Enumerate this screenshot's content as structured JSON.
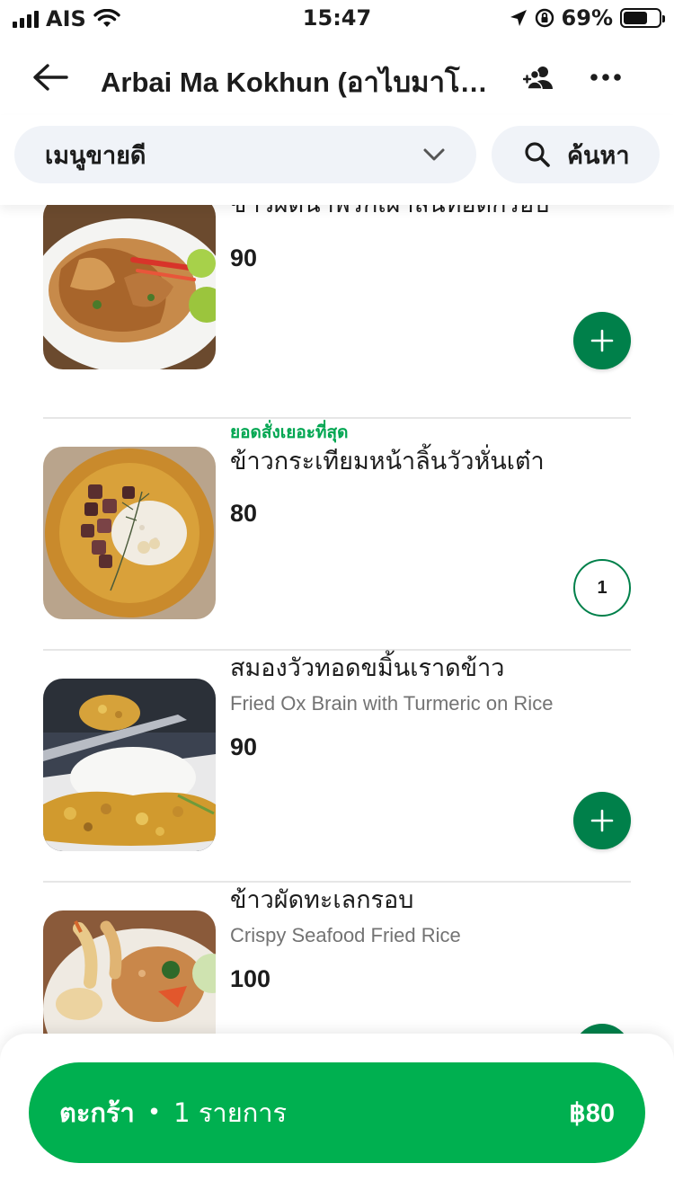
{
  "status_bar": {
    "carrier": "AIS",
    "time": "15:47",
    "battery_percent": "69%",
    "battery_level": 0.69,
    "icons": [
      "signal-icon",
      "wifi-icon",
      "location-arrow-icon",
      "rotation-lock-icon",
      "battery-icon"
    ]
  },
  "header": {
    "title": "Arbai Ma Kokhun (อาไบมาโค...",
    "back_icon": "back-arrow-icon",
    "group_icon": "group-order-icon",
    "more_icon": "more-icon"
  },
  "filter": {
    "category": "เมนูขายดี",
    "search_label": "ค้นหา",
    "search_icon": "search-icon",
    "dropdown_icon": "chevron-down-icon"
  },
  "menu": {
    "items": [
      {
        "badge": "",
        "name": "ข้าวผัดน้ำพริกเผาลิ้นทอดกรอบ",
        "subtitle": "",
        "price": "90",
        "action": "add",
        "image": "crispy-tongue-fried-rice"
      },
      {
        "badge": "ยอดสั่งเยอะที่สุด",
        "name": "ข้าวกระเทียมหน้าลิ้นวัวหั่นเต๋า",
        "subtitle": "",
        "price": "80",
        "action": "quantity",
        "quantity": "1",
        "image": "garlic-rice-diced-tongue"
      },
      {
        "badge": "",
        "name": "สมองวัวทอดขมิ้นเราดข้าว",
        "subtitle": "Fried Ox Brain with Turmeric on Rice",
        "price": "90",
        "action": "add",
        "image": "fried-ox-brain"
      },
      {
        "badge": "",
        "name": "ข้าวผัดทะเลกรอบ",
        "subtitle": "Crispy Seafood Fried Rice",
        "price": "100",
        "action": "add",
        "image": "crispy-seafood-fried-rice"
      }
    ]
  },
  "cart": {
    "label": "ตะกร้า",
    "separator": "•",
    "count_text": "1 รายการ",
    "total": "฿80"
  },
  "colors": {
    "primary_green": "#00b050",
    "dark_green": "#00804a",
    "badge_green": "#00a651",
    "pill_bg": "#f0f3f8",
    "subtitle_gray": "#737373"
  }
}
